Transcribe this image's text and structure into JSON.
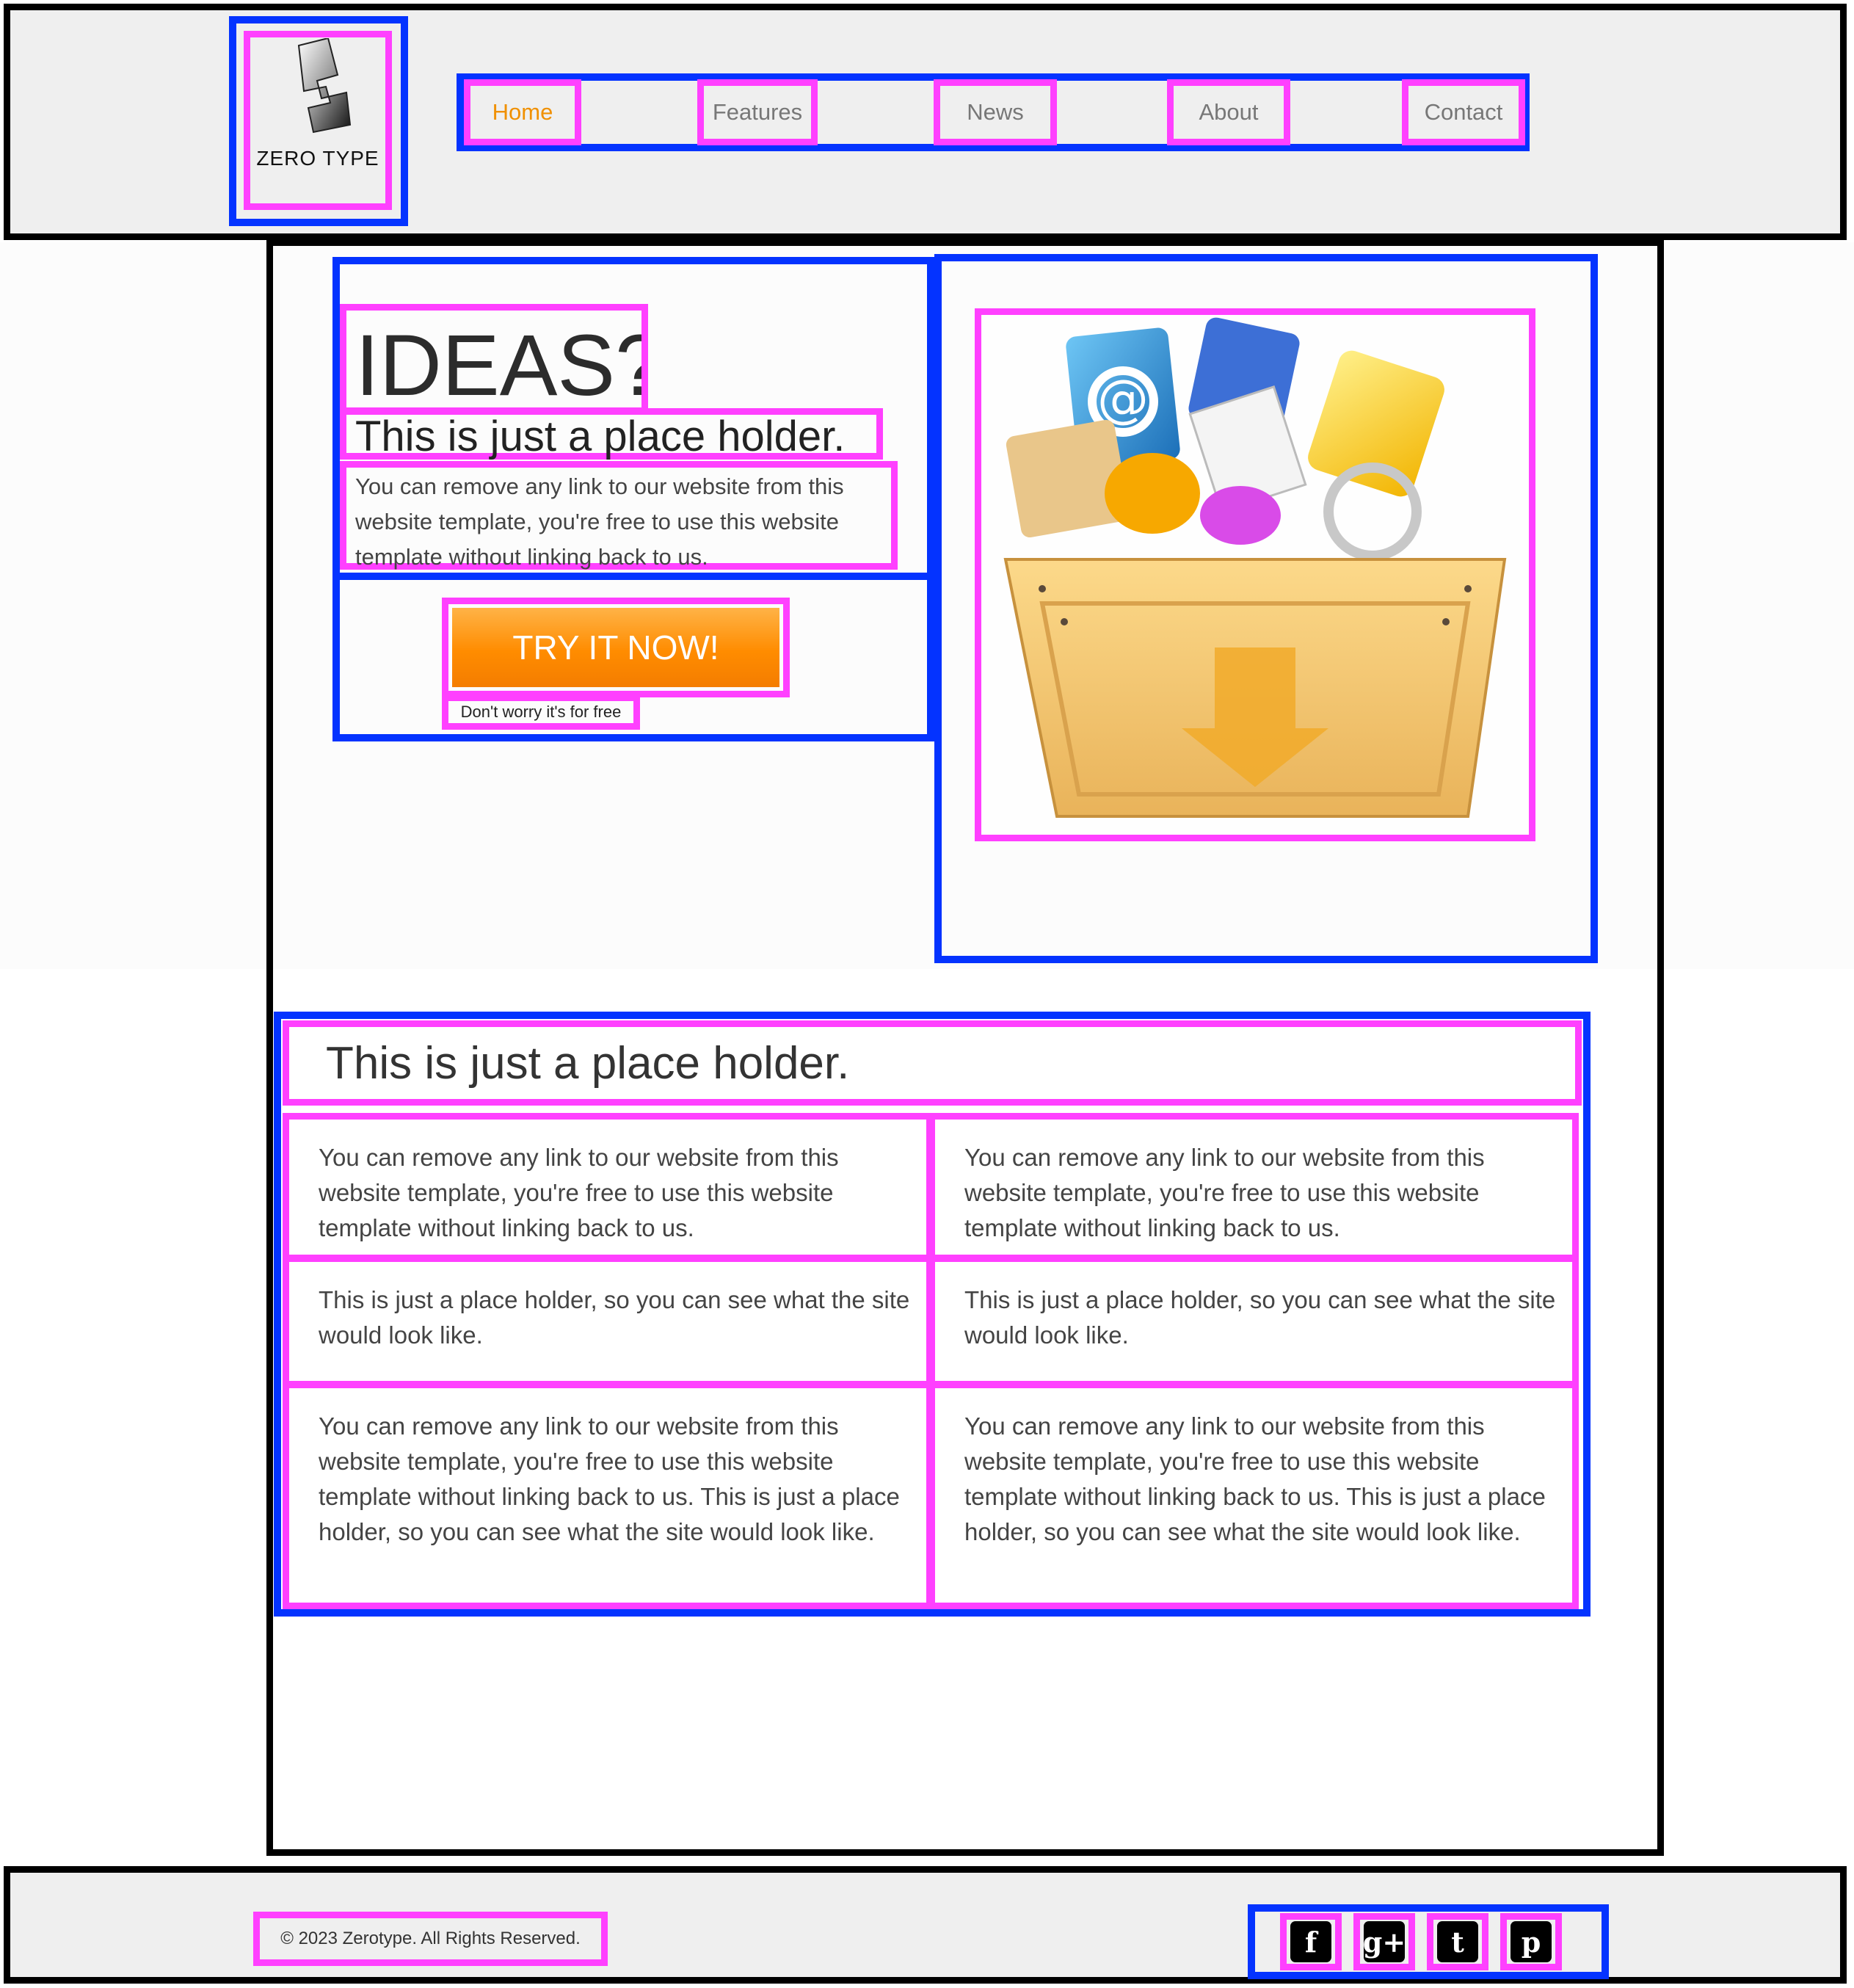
{
  "brand": {
    "name": "ZERO TYPE"
  },
  "nav": {
    "items": [
      {
        "label": "Home",
        "active": true
      },
      {
        "label": "Features"
      },
      {
        "label": "News"
      },
      {
        "label": "About"
      },
      {
        "label": "Contact"
      }
    ]
  },
  "hero": {
    "heading": "IDEAS?",
    "subheading": "This is just a place holder.",
    "body": "You can remove any link to our website from this website template, you're free to use this website template without linking back to us.",
    "cta_label": "TRY IT NOW!",
    "cta_note": "Don't worry it's for free",
    "image_icon": "app-crate-icon"
  },
  "features": {
    "title": "This is just a place holder.",
    "cells": [
      "You can remove any link to our website from this website template, you're free to use this website template without linking back to us.",
      "You can remove any link to our website from this website template, you're free to use this website template without linking back to us.",
      "This is just a place holder, so you can see what the site would look like.",
      "This is just a place holder, so you can see what the site would look like.",
      "You can remove any link to our website from this website template, you're free to use this website template without linking back to us. This is just a place holder, so you can see what the site would look like.",
      "You can remove any link to our website from this website template, you're free to use this website template without linking back to us. This is just a place holder, so you can see what the site would look like."
    ]
  },
  "footer": {
    "copyright": "© 2023 Zerotype. All Rights Reserved.",
    "social": [
      {
        "icon": "facebook-icon",
        "glyph": "f"
      },
      {
        "icon": "google-plus-icon",
        "glyph": "g+"
      },
      {
        "icon": "twitter-icon",
        "glyph": "t"
      },
      {
        "icon": "pinterest-icon",
        "glyph": "p"
      }
    ]
  },
  "colors": {
    "accent": "#f09000",
    "button": "#ff8c00",
    "outline_container": "#0433ff",
    "outline_element": "#ff40ff"
  }
}
